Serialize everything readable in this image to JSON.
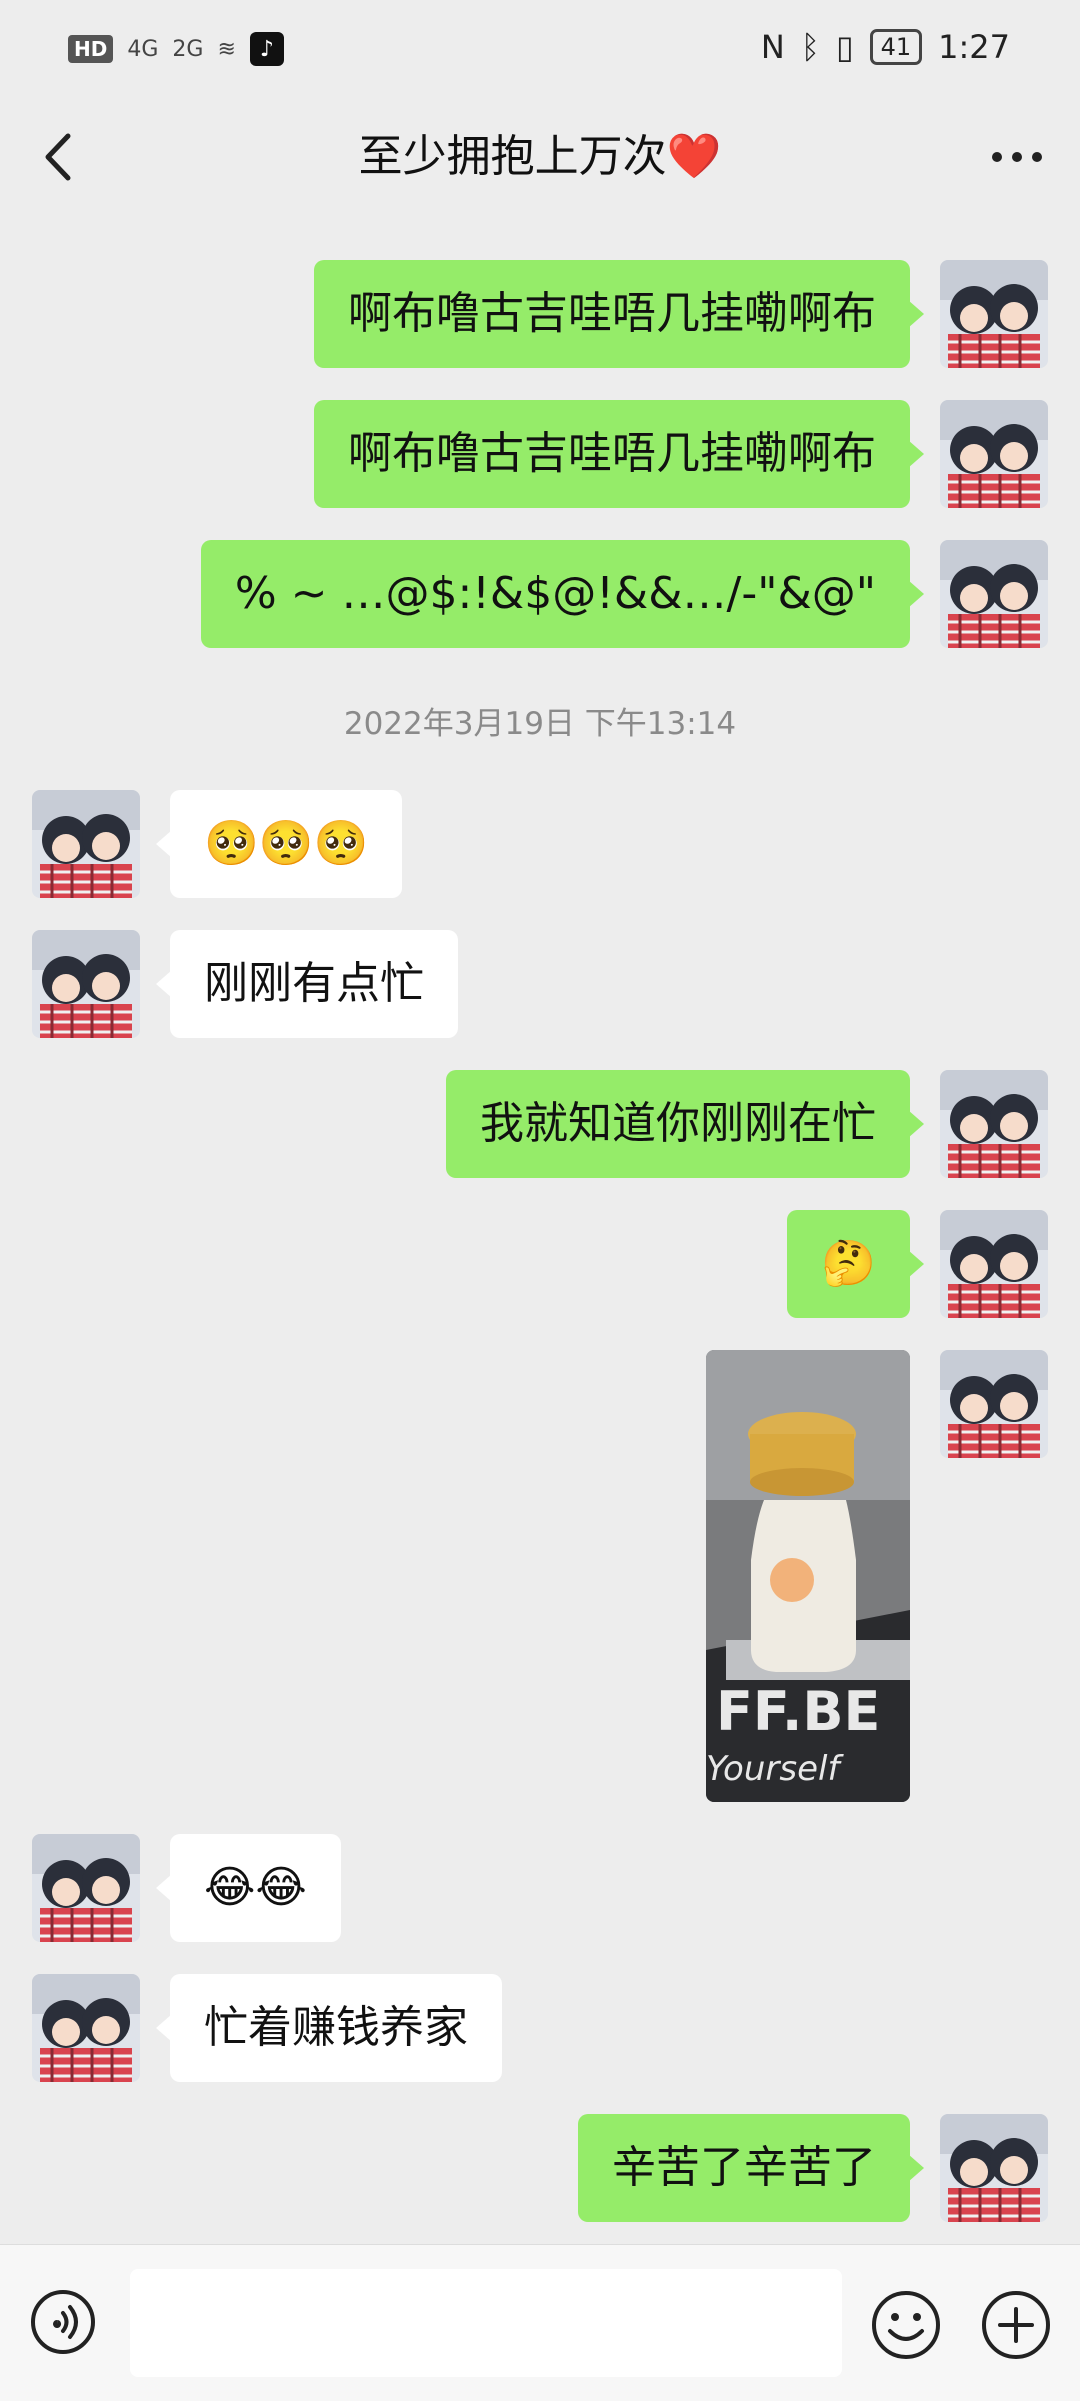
{
  "status": {
    "left_chip": "HD",
    "signal_4g": "4G",
    "signal_2g": "2G",
    "time": "1:27",
    "battery": "41"
  },
  "header": {
    "title": "至少拥抱上万次❤️"
  },
  "messages": [
    {
      "side": "out",
      "text": "啊布噜古吉哇唔几挂嘞啊布"
    },
    {
      "side": "out",
      "text": "啊布噜古吉哇唔几挂嘞啊布"
    },
    {
      "side": "out",
      "text": "% ~ …@$:!&$@!&&…/-\"&@\""
    },
    {
      "timestamp": "2022年3月19日 下午13:14"
    },
    {
      "side": "in",
      "text": "🥺🥺🥺"
    },
    {
      "side": "in",
      "text": "刚刚有点忙"
    },
    {
      "side": "out",
      "text": "我就知道你刚刚在忙"
    },
    {
      "side": "out",
      "text": "🤔"
    },
    {
      "side": "out",
      "image": "photo-bottle-on-laptop"
    },
    {
      "side": "in",
      "text": "😂😂"
    },
    {
      "side": "in",
      "text": "忙着赚钱养家"
    },
    {
      "side": "out",
      "text": "辛苦了辛苦了"
    }
  ],
  "icons": {
    "back": "chevron-left-icon",
    "more": "more-dots-icon",
    "voice": "voice-icon",
    "emoji": "emoji-icon",
    "plus": "plus-icon"
  },
  "colors": {
    "out_bubble": "#95ec69",
    "in_bubble": "#ffffff",
    "background": "#ededed"
  }
}
